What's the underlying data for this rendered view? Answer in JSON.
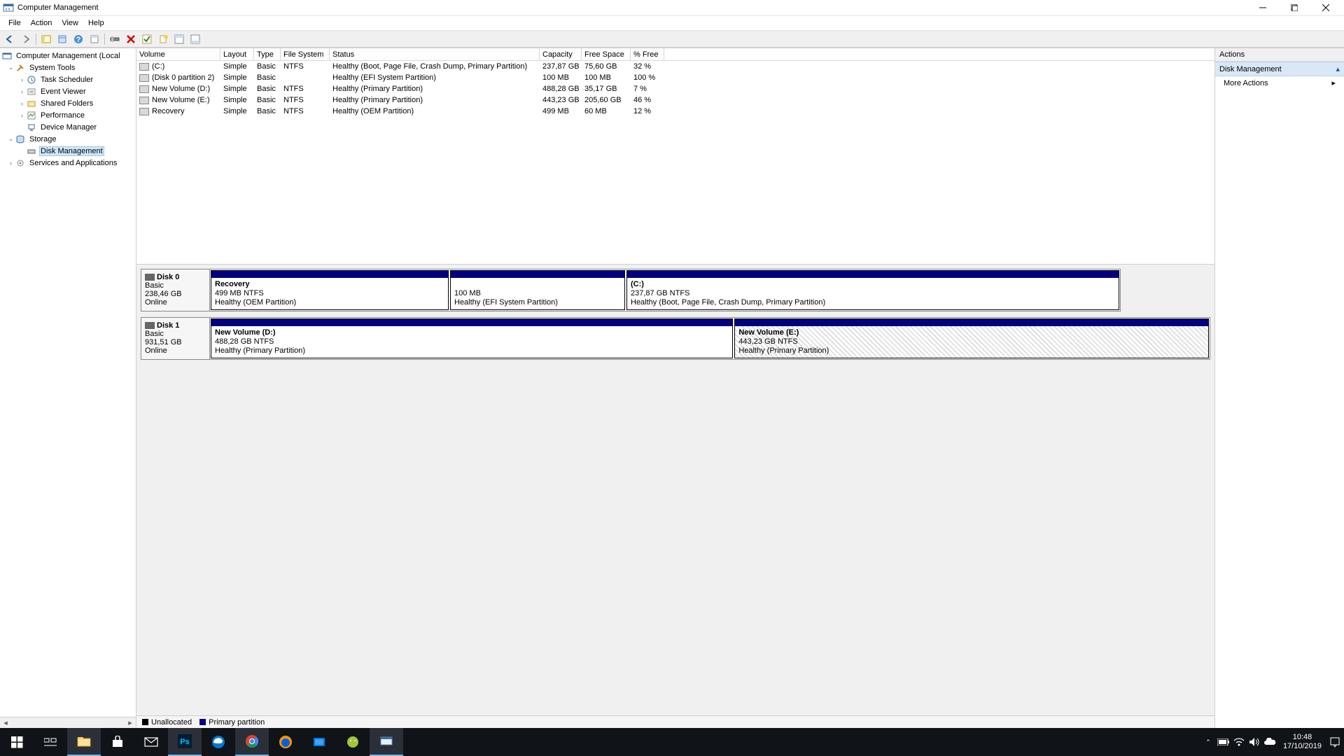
{
  "window": {
    "title": "Computer Management"
  },
  "menu": [
    "File",
    "Action",
    "View",
    "Help"
  ],
  "tree": {
    "root": "Computer Management (Local",
    "system_tools": "System Tools",
    "task_scheduler": "Task Scheduler",
    "event_viewer": "Event Viewer",
    "shared_folders": "Shared Folders",
    "performance": "Performance",
    "device_manager": "Device Manager",
    "storage": "Storage",
    "disk_management": "Disk Management",
    "services": "Services and Applications"
  },
  "columns": {
    "volume": "Volume",
    "layout": "Layout",
    "type": "Type",
    "fs": "File System",
    "status": "Status",
    "capacity": "Capacity",
    "free": "Free Space",
    "pct": "% Free"
  },
  "volumes": [
    {
      "name": "(C:)",
      "layout": "Simple",
      "type": "Basic",
      "fs": "NTFS",
      "status": "Healthy (Boot, Page File, Crash Dump, Primary Partition)",
      "capacity": "237,87 GB",
      "free": "75,60 GB",
      "pct": "32 %"
    },
    {
      "name": "(Disk 0 partition 2)",
      "layout": "Simple",
      "type": "Basic",
      "fs": "",
      "status": "Healthy (EFI System Partition)",
      "capacity": "100 MB",
      "free": "100 MB",
      "pct": "100 %"
    },
    {
      "name": "New Volume (D:)",
      "layout": "Simple",
      "type": "Basic",
      "fs": "NTFS",
      "status": "Healthy (Primary Partition)",
      "capacity": "488,28 GB",
      "free": "35,17 GB",
      "pct": "7 %"
    },
    {
      "name": "New Volume (E:)",
      "layout": "Simple",
      "type": "Basic",
      "fs": "NTFS",
      "status": "Healthy (Primary Partition)",
      "capacity": "443,23 GB",
      "free": "205,60 GB",
      "pct": "46 %"
    },
    {
      "name": "Recovery",
      "layout": "Simple",
      "type": "Basic",
      "fs": "NTFS",
      "status": "Healthy (OEM Partition)",
      "capacity": "499 MB",
      "free": "60 MB",
      "pct": "12 %"
    }
  ],
  "disks": {
    "d0": {
      "name": "Disk 0",
      "type": "Basic",
      "size": "238,46 GB",
      "status": "Online"
    },
    "d1": {
      "name": "Disk 1",
      "type": "Basic",
      "size": "931,51 GB",
      "status": "Online"
    }
  },
  "parts": {
    "recovery": {
      "title": "Recovery",
      "line2": "499 MB NTFS",
      "line3": "Healthy (OEM Partition)"
    },
    "efi": {
      "title": "",
      "line2": "100 MB",
      "line3": "Healthy (EFI System Partition)"
    },
    "c": {
      "title": "(C:)",
      "line2": "237,87 GB NTFS",
      "line3": "Healthy (Boot, Page File, Crash Dump, Primary Partition)"
    },
    "d": {
      "title": "New Volume  (D:)",
      "line2": "488,28 GB NTFS",
      "line3": "Healthy (Primary Partition)"
    },
    "e": {
      "title": "New Volume  (E:)",
      "line2": "443,23 GB NTFS",
      "line3": "Healthy (Primary Partition)"
    }
  },
  "legend": {
    "unalloc": "Unallocated",
    "primary": "Primary partition"
  },
  "actions": {
    "head": "Actions",
    "dm": "Disk Management",
    "more": "More Actions"
  },
  "taskbar": {
    "time": "10:48",
    "date": "17/10/2019"
  }
}
